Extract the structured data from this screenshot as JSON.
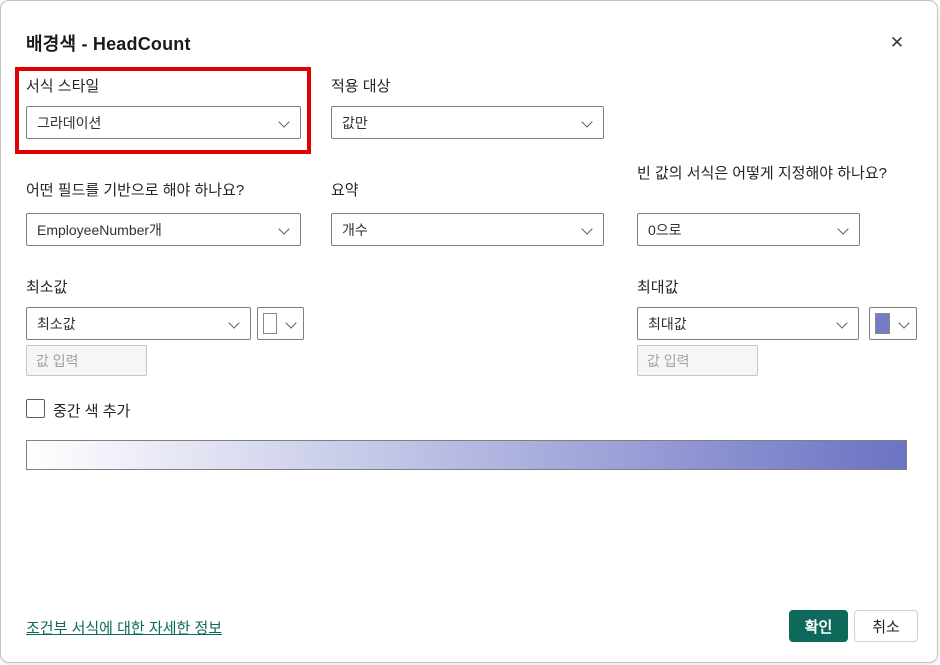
{
  "dialog": {
    "title": "배경색 - HeadCount"
  },
  "icons": {
    "close": "✕"
  },
  "format_style": {
    "label": "서식 스타일",
    "value": "그라데이션"
  },
  "apply_to": {
    "label": "적용 대상",
    "value": "값만"
  },
  "based_on": {
    "label": "어떤 필드를 기반으로 해야 하나요?",
    "value": "EmployeeNumber개"
  },
  "summarization": {
    "label": "요약",
    "value": "개수"
  },
  "blank_format": {
    "label": "빈 값의 서식은 어떻게 지정해야 하나요?",
    "value": "0으로"
  },
  "minimum": {
    "label": "최소값",
    "value": "최소값",
    "placeholder": "값 입력",
    "swatch_color": "#ffffff"
  },
  "maximum": {
    "label": "최대값",
    "value": "최대값",
    "placeholder": "값 입력",
    "swatch_color": "#747cc8"
  },
  "middle_color": {
    "label": "중간 색 추가",
    "checked": false
  },
  "gradient": {
    "start_color": "#ffffff",
    "end_color": "#6b73c4"
  },
  "footer": {
    "link_label": "조건부 서식에 대한 자세한 정보",
    "ok_label": "확인",
    "cancel_label": "취소"
  },
  "colors": {
    "highlight_red": "#e00000",
    "ok_green": "#0e695a",
    "link_teal": "#0b695c"
  }
}
